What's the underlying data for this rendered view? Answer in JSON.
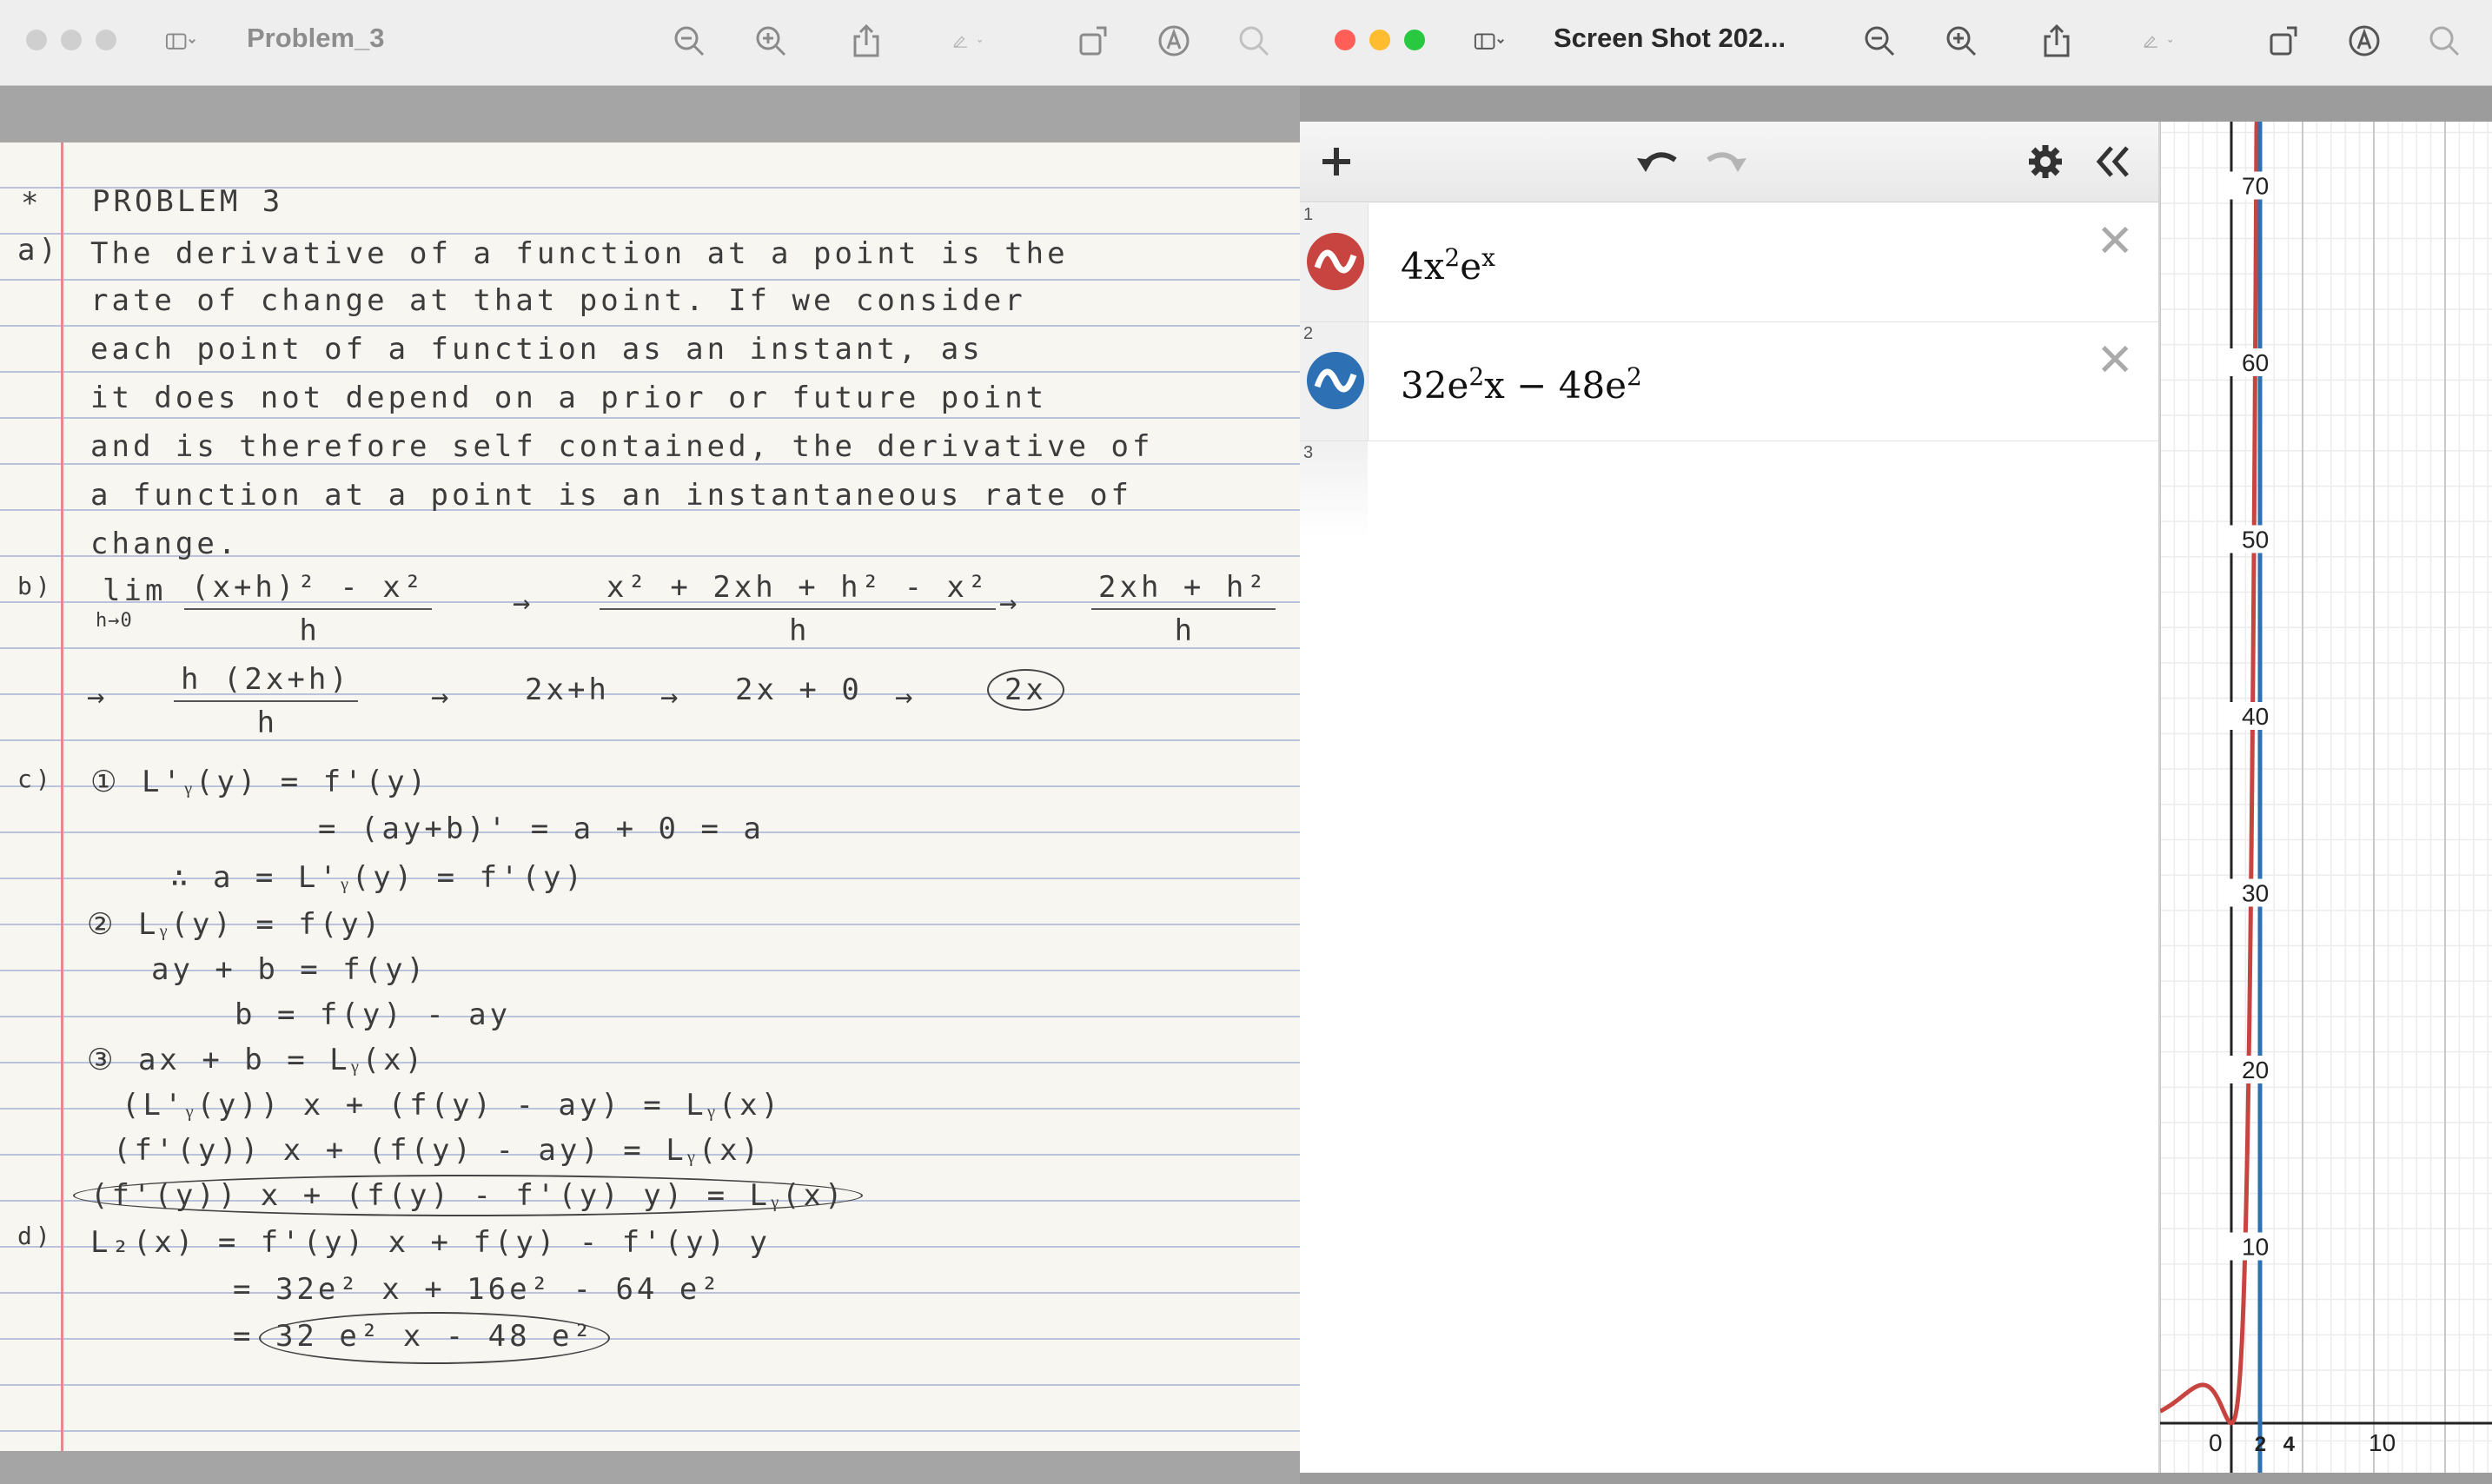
{
  "left_window": {
    "title": "Problem_3",
    "notes": {
      "star": "*",
      "heading": "PROBLEM 3",
      "a_label": "a)",
      "a_lines": [
        "The derivative of a function at a point is the",
        "rate of change at that point. If we consider",
        "each point of a function as an instant, as",
        "it does not depend on a prior or future point",
        "and is therefore self contained, the derivative of",
        "a function at a point is an instantaneous rate of",
        "change."
      ],
      "b_label": "b)",
      "b_lim": "lim",
      "b_lim_sub": "h→0",
      "b_frac1_num": "(x+h)² - x²",
      "b_frac1_den": "h",
      "b_arrow": "→",
      "b_frac2_num": "x² + 2xh + h² - x²",
      "b_frac2_den": "h",
      "b_frac3_num": "2xh + h²",
      "b_frac3_den": "h",
      "b_frac4_num": "h (2x+h)",
      "b_frac4_den": "h",
      "b_step5": "2x+h",
      "b_step6": "2x + 0",
      "b_answer": "2x",
      "c_label": "c)",
      "c_lines": [
        "① L'ᵧ(y) = f'(y)",
        "= (ay+b)' = a + 0 = a",
        "∴   a = L'ᵧ(y) = f'(y)",
        "② Lᵧ(y) = f(y)",
        "ay + b =  f(y)",
        "b = f(y) - ay",
        "③   ax + b  = Lᵧ(x)",
        "(L'ᵧ(y)) x + (f(y) - ay) = Lᵧ(x)",
        "(f'(y)) x + (f(y) - ay) = Lᵧ(x)",
        "(f'(y)) x + (f(y) - f'(y) y) = Lᵧ(x)"
      ],
      "d_label": "d)",
      "d_lines": [
        "L₂(x) = f'(y) x + f(y) - f'(y) y",
        "= 32e² x + 16e² - 64 e²",
        "= 32 e² x - 48 e²"
      ]
    }
  },
  "right_window": {
    "title": "Screen Shot 202...",
    "expressions": [
      {
        "index": "1",
        "latex_base": "4x",
        "latex_sup1": "2",
        "latex_mid": "e",
        "latex_sup2": "x",
        "latex_tail": "",
        "color": "#c74440"
      },
      {
        "index": "2",
        "latex_base": "32e",
        "latex_sup1": "2",
        "latex_mid": "x − 48e",
        "latex_sup2": "2",
        "latex_tail": "",
        "color": "#2d70b3"
      },
      {
        "index": "3"
      }
    ],
    "graph": {
      "y_ticks": [
        "70",
        "60",
        "50",
        "40",
        "30",
        "20",
        "10"
      ],
      "x_ticks": [
        "0",
        "2",
        "4",
        "10"
      ]
    }
  },
  "colors": {
    "red_light": "#ff5f57",
    "yellow_light": "#febc2e",
    "green_light": "#28c840",
    "desmos_red": "#c74440",
    "desmos_blue": "#2d70b3"
  },
  "icons": [
    "sidebar-icon",
    "zoom-out-icon",
    "zoom-in-icon",
    "share-icon",
    "markup-icon",
    "rotate-icon",
    "annotate-icon",
    "search-icon",
    "plus-icon",
    "undo-icon",
    "redo-icon",
    "gear-icon",
    "collapse-icon",
    "close-icon"
  ]
}
